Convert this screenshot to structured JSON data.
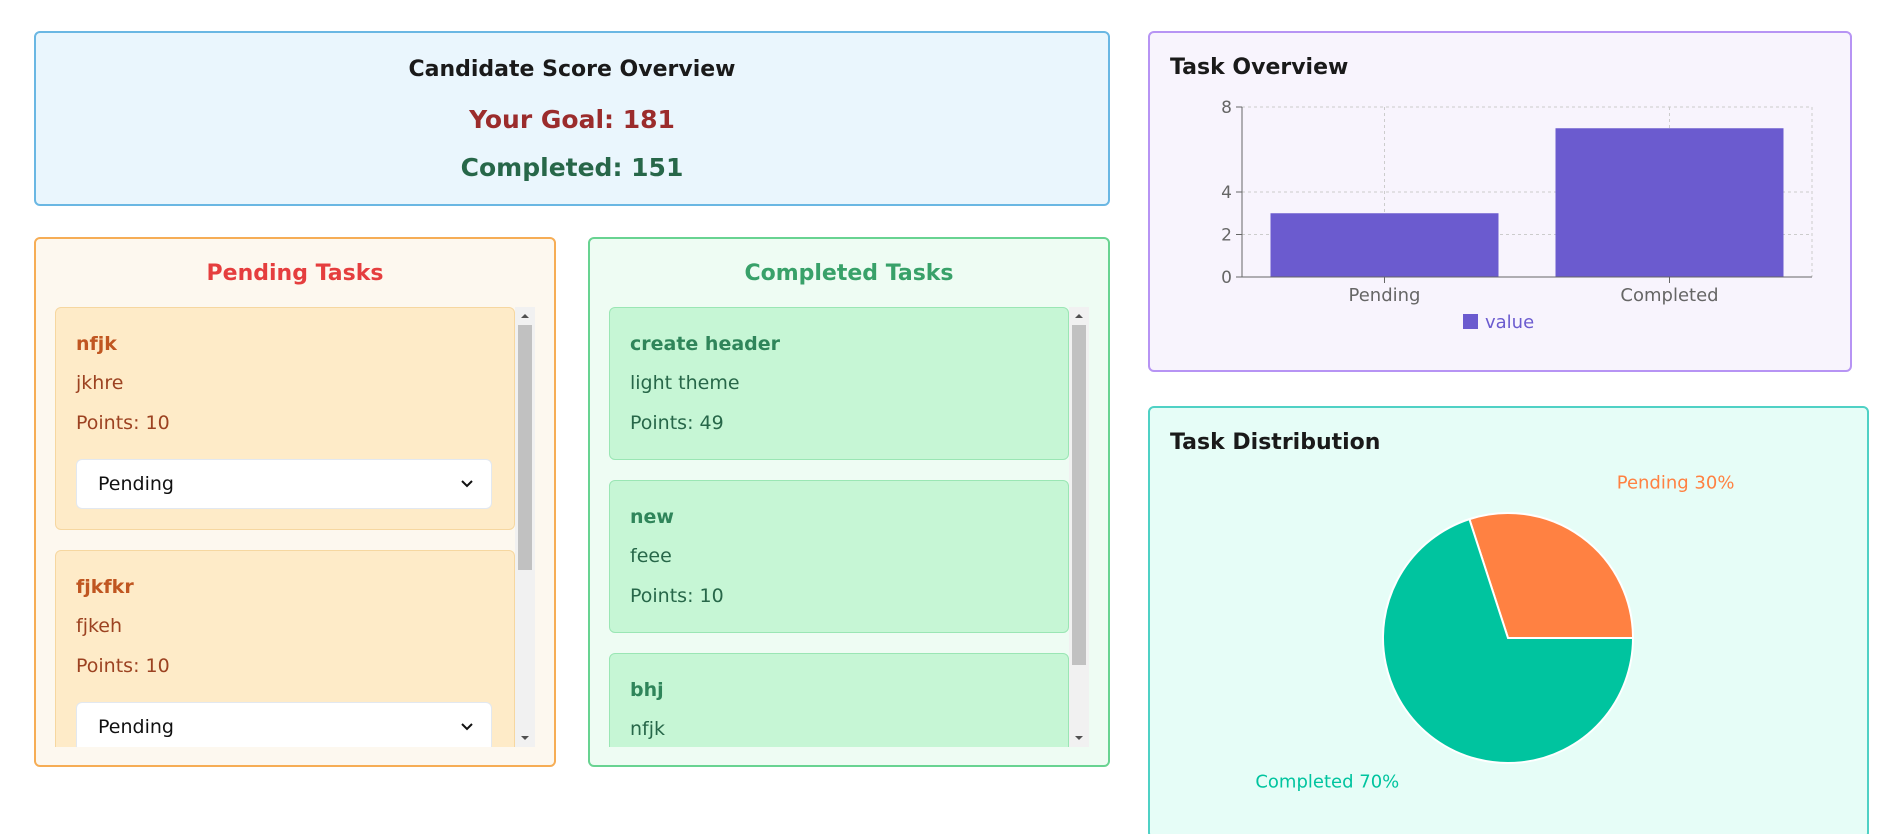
{
  "score": {
    "title": "Candidate Score Overview",
    "goal": "Your Goal: 181",
    "completed": "Completed: 151"
  },
  "pending": {
    "title": "Pending Tasks",
    "tasks": [
      {
        "name": "nfjk",
        "description": "jkhre",
        "points": "Points: 10",
        "status": "Pending"
      },
      {
        "name": "fjkfkr",
        "description": "fjkeh",
        "points": "Points: 10",
        "status": "Pending"
      }
    ]
  },
  "completed": {
    "title": "Completed Tasks",
    "tasks": [
      {
        "name": "create header",
        "description": "light theme",
        "points": "Points: 49"
      },
      {
        "name": "new",
        "description": "feee",
        "points": "Points: 10"
      },
      {
        "name": "bhj",
        "description": "nfjk",
        "points": ""
      }
    ]
  },
  "chart_data": [
    {
      "type": "bar",
      "title": "Task Overview",
      "categories": [
        "Pending",
        "Completed"
      ],
      "series": [
        {
          "name": "value",
          "values": [
            3,
            7
          ]
        }
      ],
      "yticks": [
        0,
        2,
        4,
        8
      ],
      "ylim": [
        0,
        8
      ],
      "grid": true,
      "legend": "bottom",
      "colors": {
        "bar": "#6b5bcf",
        "axis": "#666666",
        "grid": "#cccccc"
      }
    },
    {
      "type": "pie",
      "title": "Task Distribution",
      "labels": [
        "Pending",
        "Completed"
      ],
      "values": [
        30,
        70
      ],
      "slice_labels": [
        "Pending 30%",
        "Completed 70%"
      ],
      "colors": [
        "#ff8142",
        "#00c49f"
      ]
    }
  ]
}
